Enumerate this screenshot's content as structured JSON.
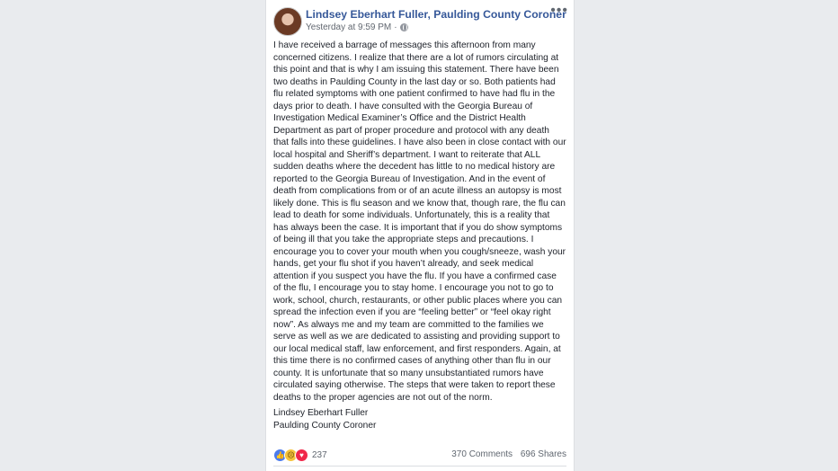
{
  "post": {
    "author": "Lindsey Eberhart Fuller, Paulding County Coroner",
    "timestamp": "Yesterday at 9:59 PM",
    "separator": "·",
    "privacy_icon": "globe-icon",
    "more_icon": "more-options-icon",
    "body": "I have received a barrage of messages this afternoon from many concerned citizens. I realize that there are a lot of rumors circulating at this point and that is why I am issuing this statement. There have been two deaths in Paulding County in the last day or so. Both patients had flu related symptoms with one patient confirmed to have had flu in the days prior to death. I have consulted with the Georgia Bureau of Investigation Medical Examiner’s Office and the District Health Department as part of proper procedure and protocol with any death that falls into these guidelines. I have also been in close contact with our local hospital and Sheriff’s department. I want to reiterate that ALL sudden deaths where the decedent has little to no medical history are reported to the Georgia Bureau of Investigation. And in the event of death from complications from or of an acute illness an autopsy is most likely done. This is flu season and we know that, though rare, the flu can lead to death for some individuals. Unfortunately, this is a reality that has always been the case. It is important that if you do show symptoms of being ill that you take the appropriate steps and precautions. I encourage you to cover your mouth when you cough/sneeze, wash your hands, get your flu shot if you haven’t already, and seek medical attention if you suspect you have the flu. If you have a confirmed case of the flu, I encourage you to stay home. I encourage you not to go to work, school, church, restaurants, or other public places where you can spread the infection even if you are “feeling better” or “feel okay right now”. As always me and my team are committed to the families we serve as well as we are dedicated to assisting and providing support to our local medical staff, law enforcement, and first responders. Again, at this time there is no confirmed cases of anything other than flu in our county. It is unfortunate that so many unsubstantiated rumors have circulated saying otherwise. The steps that were taken to report these deaths to the proper agencies are not out of the norm.",
    "signature_name": "Lindsey Eberhart Fuller",
    "signature_title": "Paulding County Coroner",
    "reactions": {
      "icons": [
        "like-icon",
        "sad-icon",
        "love-icon"
      ],
      "count": "237"
    },
    "comments": "370 Comments",
    "shares": "696 Shares"
  },
  "colors": {
    "page_bg": "#e9ebee",
    "author_link": "#365899",
    "text": "#1d2129",
    "meta": "#616770"
  }
}
